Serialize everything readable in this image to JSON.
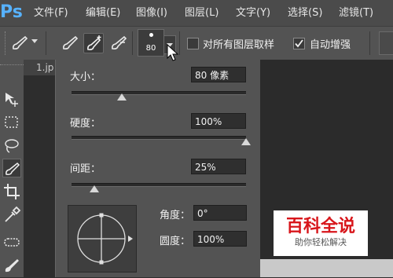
{
  "app": {
    "logo": "Ps"
  },
  "menu": [
    "文件(F)",
    "编辑(E)",
    "图像(I)",
    "图层(L)",
    "文字(Y)",
    "选择(S)",
    "滤镜(T)"
  ],
  "options": {
    "brush_size": "80",
    "sample_all_layers_label": "对所有图层取样",
    "auto_enhance_label": "自动增强",
    "sample_all_layers_checked": false,
    "auto_enhance_checked": true
  },
  "document_tab": "1.jp",
  "brush_panel": {
    "size_label": "大小：",
    "size_value": "80 像素",
    "size_slider_level": 0.29,
    "hardness_label": "硬度：",
    "hardness_value": "100%",
    "hardness_slider_level": 1.0,
    "spacing_label": "间距：",
    "spacing_value": "25%",
    "spacing_slider_level": 0.13,
    "angle_label": "角度：",
    "angle_value": "0°",
    "roundness_label": "圆度：",
    "roundness_value": "100%"
  },
  "watermark": {
    "title": "百科全说",
    "subtitle": "助你轻松解决"
  },
  "colors": {
    "accent_blue": "#57b2ff",
    "watermark_red": "#d8161b"
  },
  "icons": [
    "brush-icon",
    "quick-selection-icon",
    "marquee-icon",
    "lasso-icon",
    "crop-icon",
    "eyedropper-icon",
    "healing-icon",
    "mouse-cursor-icon"
  ]
}
